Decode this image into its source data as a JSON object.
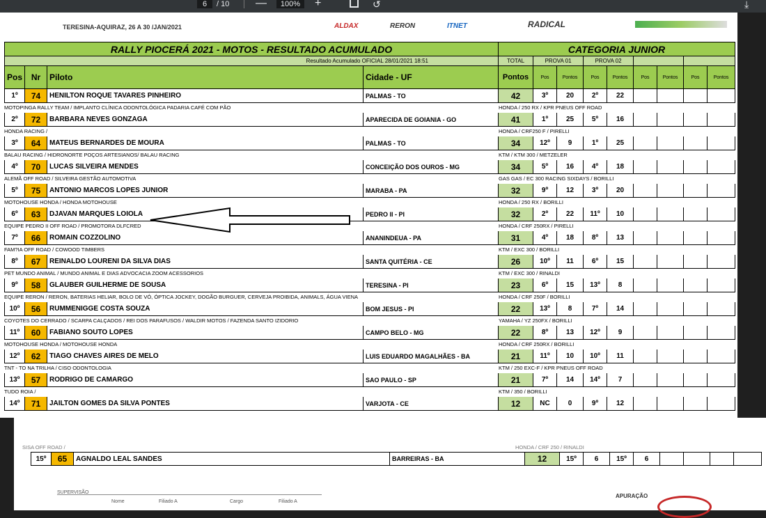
{
  "toolbar": {
    "page_current": "6",
    "page_total": "/ 10",
    "minus": "—",
    "zoom": "100%",
    "plus": "+",
    "rotate_icon": "↺",
    "download_icon": "⤓"
  },
  "document": {
    "header_location": "TERESINA-AQUIRAZ, 26 A 30 /JAN/2021",
    "sponsors": [
      "ALDAX",
      "RERON",
      "ITNET",
      "RADICAL"
    ],
    "title": "RALLY PIOCERÁ 2021 - MOTOS - RESULTADO ACUMULADO",
    "category": "CATEGORIA JUNIOR",
    "official": "Resultado Acumulado OFICIAL 28/01/2021 18:51",
    "total_label": "TOTAL",
    "prova01": "PROVA 01",
    "prova02": "PROVA 02",
    "columns": {
      "pos": "Pos",
      "nr": "Nr",
      "piloto": "Piloto",
      "cidade": "Cidade - UF",
      "pontos": "Pontos",
      "pos_short": "Pos",
      "pontos_short": "Pontos"
    },
    "rows": [
      {
        "pos": "1º",
        "nr": "74",
        "piloto": "HENILTON ROQUE TAVARES PINHEIRO",
        "cidade": "PALMAS - TO",
        "pontos": "42",
        "p1pos": "3º",
        "p1pts": "20",
        "p2pos": "2º",
        "p2pts": "22",
        "team": "MOTOPINGA RALLY TEAM / IMPLANTO CLÍNICA ODONTOLÓGICA PADARIA CAFÉ COM PÃO",
        "moto": "HONDA / 250 RX / KPR PNEUS OFF ROAD"
      },
      {
        "pos": "2º",
        "nr": "72",
        "piloto": "BARBARA NEVES GONZAGA",
        "cidade": "APARECIDA DE GOIANIA - GO",
        "pontos": "41",
        "p1pos": "1º",
        "p1pts": "25",
        "p2pos": "5º",
        "p2pts": "16",
        "team": "HONDA RACING /",
        "moto": "HONDA / CRF250 F / PIRELLI"
      },
      {
        "pos": "3º",
        "nr": "64",
        "piloto": "MATEUS BERNARDES DE MOURA",
        "cidade": "PALMAS - TO",
        "pontos": "34",
        "p1pos": "12º",
        "p1pts": "9",
        "p2pos": "1º",
        "p2pts": "25",
        "team": "BALAU RACING / HIDRONORTE POÇOS ARTESIANOS/ BALAU RACING",
        "moto": "KTM / KTM 300 / METZELER"
      },
      {
        "pos": "4º",
        "nr": "70",
        "piloto": "LUCAS SILVEIRA MENDES",
        "cidade": "CONCEIÇÃO DOS OUROS - MG",
        "pontos": "34",
        "p1pos": "5º",
        "p1pts": "16",
        "p2pos": "4º",
        "p2pts": "18",
        "team": "ALEMÃ OFF ROAD / SILVEIRA GESTÃO AUTOMOTIVA",
        "moto": "GAS GAS / EC 300 RACING SIXDAYS / BORILLI"
      },
      {
        "pos": "5º",
        "nr": "75",
        "piloto": "ANTONIO MARCOS LOPES JUNIOR",
        "cidade": "MARABA - PA",
        "pontos": "32",
        "p1pos": "9º",
        "p1pts": "12",
        "p2pos": "3º",
        "p2pts": "20",
        "team": "MOTOHOUSE HONDA / HONDA MOTOHOUSE",
        "moto": "HONDA / 250 RX / BORILLI"
      },
      {
        "pos": "6º",
        "nr": "63",
        "piloto": "DJAVAN MARQUES LOIOLA",
        "cidade": "PEDRO II - PI",
        "pontos": "32",
        "p1pos": "2º",
        "p1pts": "22",
        "p2pos": "11º",
        "p2pts": "10",
        "team": "EQUIPE PEDRO II OFF ROAD / PROMOTORA DLFCRED",
        "moto": "HONDA / CRF 250RX / PIRELLI"
      },
      {
        "pos": "7º",
        "nr": "66",
        "piloto": "ROMAIN COZZOLINO",
        "cidade": "ANANINDEUA - PA",
        "pontos": "31",
        "p1pos": "4º",
        "p1pts": "18",
        "p2pos": "8º",
        "p2pts": "13",
        "team": "FAM?IA OFF ROAD / COWOOD TIMBERS",
        "moto": "KTM / EXC 300 / BORILLI"
      },
      {
        "pos": "8º",
        "nr": "67",
        "piloto": "REINALDO LOURENI DA SILVA DIAS",
        "cidade": "SANTA QUITÉRIA - CE",
        "pontos": "26",
        "p1pos": "10º",
        "p1pts": "11",
        "p2pos": "6º",
        "p2pts": "15",
        "team": "PET MUNDO ANIMAL / MUNDO ANIMAL E DIAS ADVOCACIA ZOOM ACESSORIOS",
        "moto": "KTM / EXC 300 / RINALDI"
      },
      {
        "pos": "9º",
        "nr": "58",
        "piloto": "GLAUBER GUILHERME DE SOUSA",
        "cidade": "TERESINA - PI",
        "pontos": "23",
        "p1pos": "6º",
        "p1pts": "15",
        "p2pos": "13º",
        "p2pts": "8",
        "team": "EQUIPE RERON / RERON, BATERIAS HELIAR, BOLO DE VÓ, ÓPTICA JOCKEY, DOGÃO BURGUER, CERVEJA PROIBIDA, ANIMALS, ÁGUA VIENA",
        "moto": "HONDA / CRF 250F / BORILLI"
      },
      {
        "pos": "10º",
        "nr": "56",
        "piloto": "RUMMENIGGE COSTA SOUZA",
        "cidade": "BOM JESUS - PI",
        "pontos": "22",
        "p1pos": "13º",
        "p1pts": "8",
        "p2pos": "7º",
        "p2pts": "14",
        "team": "COYOTES DO CERRADO / SCARPA CALÇADOS / REI DOS PARAFUSOS / WALDIR MOTOS / FAZENDA SANTO IZIDORIO",
        "moto": "YAMAHA / YZ 250FX / BORILLI"
      },
      {
        "pos": "11º",
        "nr": "60",
        "piloto": "FABIANO SOUTO LOPES",
        "cidade": "CAMPO BELO - MG",
        "pontos": "22",
        "p1pos": "8º",
        "p1pts": "13",
        "p2pos": "12º",
        "p2pts": "9",
        "team": "MOTOHOUSE HONDA / MOTOHOUSE HONDA",
        "moto": "HONDA / CRF 250RX / BORILLI"
      },
      {
        "pos": "12º",
        "nr": "62",
        "piloto": "TIAGO CHAVES AIRES DE MELO",
        "cidade": "LUIS EDUARDO MAGALHÃES - BA",
        "pontos": "21",
        "p1pos": "11º",
        "p1pts": "10",
        "p2pos": "10º",
        "p2pts": "11",
        "team": "TNT - TO NA TRILHA / CISO ODONTOLOGIA",
        "moto": "KTM / 250 EXC-F / KPR PNEUS OFF ROAD"
      },
      {
        "pos": "13º",
        "nr": "57",
        "piloto": "RODRIGO DE CAMARGO",
        "cidade": "SAO PAULO - SP",
        "pontos": "21",
        "p1pos": "7º",
        "p1pts": "14",
        "p2pos": "14º",
        "p2pts": "7",
        "team": "TUDO ROIA /",
        "moto": "KTM / 350 / BORILLI"
      },
      {
        "pos": "14º",
        "nr": "71",
        "piloto": "JAILTON GOMES DA SILVA PONTES",
        "cidade": "VARJOTA - CE",
        "pontos": "12",
        "p1pos": "NC",
        "p1pts": "0",
        "p2pos": "9º",
        "p2pts": "12",
        "team": "",
        "moto": ""
      }
    ],
    "last_row": {
      "pos": "15º",
      "nr": "65",
      "piloto": "AGNALDO LEAL SANDES",
      "cidade": "BARREIRAS - BA",
      "pontos": "12",
      "p1pos": "15º",
      "p1pts": "6",
      "p2pos": "15º",
      "p2pts": "6",
      "team": "SISA OFF ROAD /",
      "moto": "HONDA / CRF 250 / RINALDI"
    },
    "footer": {
      "supervisao": "SUPERVISÃO",
      "apuracao": "APURAÇÃO",
      "nome": "Nome",
      "filiado": "Filiado A",
      "cargo": "Cargo",
      "filiado2": "Filiado A"
    }
  }
}
